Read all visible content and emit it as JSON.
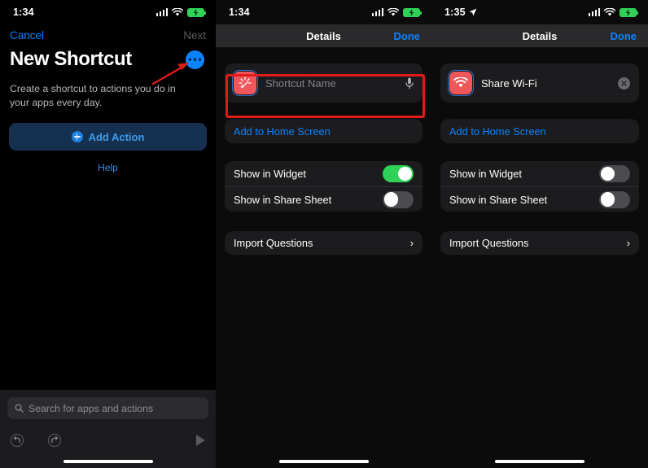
{
  "panels": [
    {
      "id": "new-shortcut",
      "status": {
        "time": "1:34",
        "has_location_arrow": false
      },
      "nav": {
        "cancel": "Cancel",
        "next": "Next"
      },
      "title": "New Shortcut",
      "subtitle": "Create a shortcut to actions you do in your apps every day.",
      "add_action_label": "Add Action",
      "help_label": "Help",
      "search_placeholder": "Search for apps and actions"
    },
    {
      "id": "details-empty",
      "status": {
        "time": "1:34",
        "has_location_arrow": false
      },
      "nav": {
        "title": "Details",
        "done": "Done"
      },
      "name_placeholder": "Shortcut Name",
      "name_value": "",
      "add_to_home_screen": "Add to Home Screen",
      "toggles": [
        {
          "label": "Show in Widget",
          "on": true
        },
        {
          "label": "Show in Share Sheet",
          "on": false
        }
      ],
      "import_questions": "Import Questions"
    },
    {
      "id": "details-named",
      "status": {
        "time": "1:35",
        "has_location_arrow": true
      },
      "nav": {
        "title": "Details",
        "done": "Done"
      },
      "name_placeholder": "Shortcut Name",
      "name_value": "Share Wi-Fi",
      "add_to_home_screen": "Add to Home Screen",
      "toggles": [
        {
          "label": "Show in Widget",
          "on": false
        },
        {
          "label": "Show in Share Sheet",
          "on": false
        }
      ],
      "import_questions": "Import Questions"
    }
  ],
  "colors": {
    "accent_blue": "#0a84ff",
    "annotation_red": "#e01b18",
    "toggle_on_green": "#2fd158",
    "app_icon_red": "#f0575c",
    "battery_green": "#31d158"
  }
}
